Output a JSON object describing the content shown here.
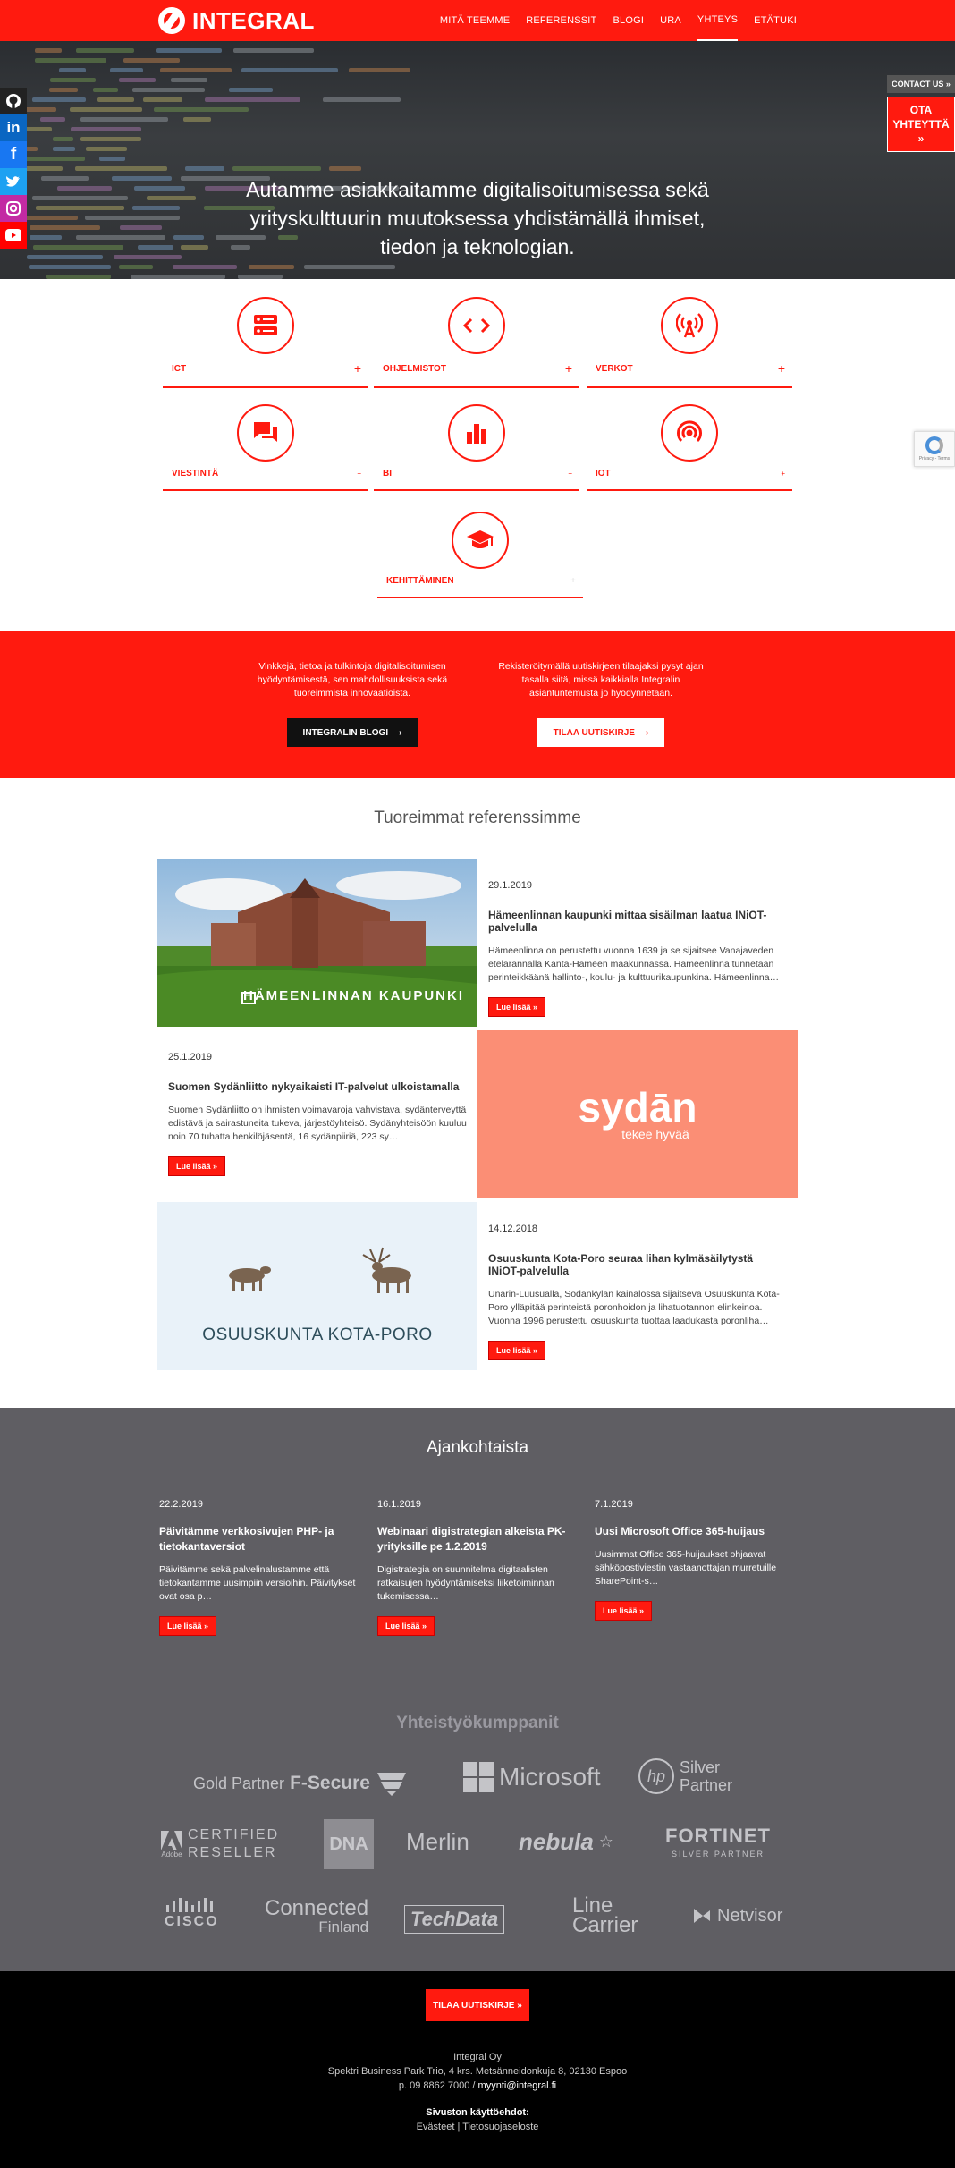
{
  "nav": {
    "logo": "INTEGRAL",
    "items": [
      "MITÄ TEEMME",
      "REFERENSSIT",
      "BLOGI",
      "URA",
      "YHTEYS",
      "ETÄTUKI"
    ],
    "active": "YHTEYS"
  },
  "hero": {
    "lines": [
      "Autamme asiakkaitamme digitalisoitumisessa sekä",
      "yrityskulttuurin muutoksessa yhdistämällä ihmiset,",
      "tiedon ja teknologian."
    ]
  },
  "social": [
    "github-icon",
    "linkedin-icon",
    "facebook-icon",
    "twitter-icon",
    "instagram-icon",
    "youtube-icon"
  ],
  "contact": {
    "tag": "CONTACT US »",
    "button_line1": "OTA",
    "button_line2": "YHTEYTTÄ »"
  },
  "recaptcha": {
    "text": "Privacy - Terms"
  },
  "services": [
    {
      "label": "ICT",
      "icon": "server-icon",
      "toggle": "+"
    },
    {
      "label": "OHJELMISTOT",
      "icon": "code-icon",
      "toggle": "+"
    },
    {
      "label": "VERKOT",
      "icon": "antenna-icon",
      "toggle": "+"
    },
    {
      "label": "VIESTINTÄ",
      "icon": "chat-icon",
      "toggle": "+"
    },
    {
      "label": "BI",
      "icon": "bar-chart-icon",
      "toggle": "+"
    },
    {
      "label": "IOT",
      "icon": "signal-icon",
      "toggle": "+"
    },
    {
      "label": "KEHITTÄMINEN",
      "icon": "graduation-cap-icon",
      "toggle": "+"
    }
  ],
  "promo": {
    "blog_text": "Vinkkejä, tietoa ja tulkintoja digitalisoitumisen hyödyntämisestä, sen mahdollisuuksista sekä tuoreimmista innovaatioista.",
    "blog_button": "INTEGRALIN BLOGI",
    "newsletter_text": "Rekisteröitymällä uutiskirjeen tilaajaksi pysyt ajan tasalla siitä, missä kaikkialla Integralin asiantuntemusta jo hyödynnetään.",
    "newsletter_button": "TILAA UUTISKIRJE"
  },
  "references": {
    "title": "Tuoreimmat referenssimme",
    "items": [
      {
        "date": "29.1.2019",
        "title": "Hämeenlinnan kaupunki mittaa sisäilman laatua INiOT-palvelulla",
        "desc": "Hämeenlinna on perustettu vuonna 1639 ja se sijaitsee Vanajaveden etelärannalla Kanta-Hämeen maakunnassa. Hämeenlinna tunnetaan perinteikkäänä hallinto-, koulu- ja kulttuurikaupunkina. Hämeenlinna…",
        "image_caption": "HÄMEENLINNAN KAUPUNKI",
        "button": "Lue lisää »"
      },
      {
        "date": "25.1.2019",
        "title": "Suomen Sydänliitto nykyaikaisti IT-palvelut ulkoistamalla",
        "desc": "Suomen Sydänliitto on ihmisten voimavaroja vahvistava, sydänterveyttä edistävä ja sairastuneita tukeva, järjestöyhteisö. Sydänyhteisöön kuuluu noin 70 tuhatta henkilöjäsentä, 16 sydänpiiriä, 223 sy…",
        "image_brand": "sydān",
        "image_tagline": "tekee hyvää",
        "button": "Lue lisää »"
      },
      {
        "date": "14.12.2018",
        "title": "Osuuskunta Kota-Poro seuraa lihan kylmäsäilytystä INiOT-palvelulla",
        "desc": "Unarin-Luusualla, Sodankylän kainalossa sijaitseva Osuuskunta Kota-Poro ylläpitää perinteistä poronhoidon ja lihatuotannon elinkeinoa. Vuonna 1996 perustettu osuuskunta tuottaa laadukasta poronliha…",
        "image_caption": "OSUUSKUNTA KOTA-PORO",
        "button": "Lue lisää »"
      }
    ]
  },
  "news": {
    "title": "Ajankohtaista",
    "items": [
      {
        "date": "22.2.2019",
        "title": "Päivitämme verkkosivujen PHP- ja tietokantaversiot",
        "desc": "Päivitämme sekä palvelinalustamme että tietokantamme uusimpiin versioihin. Päivitykset ovat osa p…",
        "button": "Lue lisää »"
      },
      {
        "date": "16.1.2019",
        "title": "Webinaari digistrategian alkeista PK-yrityksille pe 1.2.2019",
        "desc": "Digistrategia on suunnitelma digitaalisten ratkaisujen hyödyntämiseksi liiketoiminnan tukemisessa…",
        "button": "Lue lisää »"
      },
      {
        "date": "7.1.2019",
        "title": "Uusi Microsoft Office 365-huijaus",
        "desc": "Uusimmat Office 365-huijaukset ohjaavat sähköpostiviestin vastaanottajan murretuille SharePoint-s…",
        "button": "Lue lisää »"
      }
    ]
  },
  "partners": {
    "title": "Yhteistyökumppanit",
    "logos": [
      {
        "name": "Gold Partner F-Secure",
        "text1": "Gold Partner",
        "text2": "F-Secure"
      },
      {
        "name": "Microsoft",
        "text1": "Microsoft"
      },
      {
        "name": "hp Silver Partner",
        "text1": "hp",
        "text2": "Silver",
        "text3": "Partner"
      },
      {
        "name": "Adobe Certified Reseller",
        "text1": "Adobe",
        "text2": "CERTIFIED",
        "text3": "RESELLER"
      },
      {
        "name": "DNA",
        "text1": "DNA"
      },
      {
        "name": "Merlin",
        "text1": "Merlin"
      },
      {
        "name": "nebula",
        "text1": "nebula"
      },
      {
        "name": "Fortinet Silver Partner",
        "text1": "FORTINET",
        "text2": "SILVER PARTNER"
      },
      {
        "name": "Cisco",
        "text1": "CISCO"
      },
      {
        "name": "Connected Finland",
        "text1": "Connected",
        "text2": "Finland"
      },
      {
        "name": "TechData",
        "text1": "TechData"
      },
      {
        "name": "Line Carrier",
        "text1": "Line",
        "text2": "Carrier"
      },
      {
        "name": "Netvisor",
        "text1": "Netvisor"
      }
    ]
  },
  "footer": {
    "subscribe": "TILAA UUTISKIRJE »",
    "company": "Integral Oy",
    "address": "Spektri Business Park Trio, 4 krs. Metsänneidonkuja 8, 02130 Espoo",
    "phone": "p. 09 8862 7000 /",
    "email": "myynti@integral.fi",
    "terms_title": "Sivuston käyttöehdot:",
    "cookies": "Evästeet",
    "separator": "|",
    "privacy": "Tietosuojaseloste"
  },
  "colors": {
    "brand_red": "#ff1a0f",
    "dark_gray": "#5f5e63",
    "footer_black": "#000000"
  }
}
